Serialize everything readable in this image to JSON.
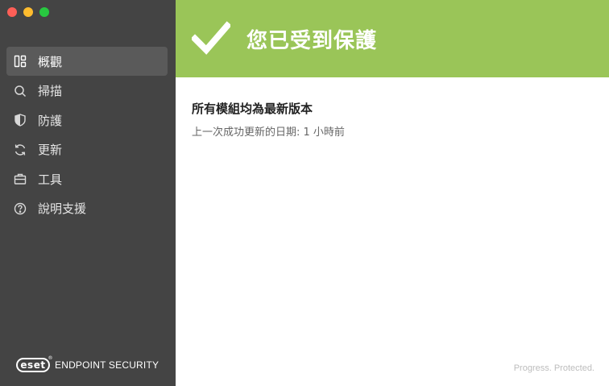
{
  "window": {
    "controls": [
      "close",
      "minimize",
      "maximize"
    ]
  },
  "sidebar": {
    "items": [
      {
        "label": "概觀",
        "icon": "overview-icon",
        "active": true
      },
      {
        "label": "掃描",
        "icon": "search-icon",
        "active": false
      },
      {
        "label": "防護",
        "icon": "shield-icon",
        "active": false
      },
      {
        "label": "更新",
        "icon": "refresh-icon",
        "active": false
      },
      {
        "label": "工具",
        "icon": "briefcase-icon",
        "active": false
      },
      {
        "label": "說明支援",
        "icon": "help-icon",
        "active": false
      }
    ],
    "brand": {
      "logo_text": "eset",
      "registered": "®",
      "product": "ENDPOINT SECURITY"
    }
  },
  "banner": {
    "title": "您已受到保護",
    "icon": "checkmark-icon"
  },
  "main": {
    "status_title": "所有模組均為最新版本",
    "status_subtitle": "上一次成功更新的日期:  1 小時前"
  },
  "footer": {
    "tagline": "Progress. Protected."
  },
  "colors": {
    "sidebar_bg": "#444444",
    "sidebar_active": "#5a5a5a",
    "banner_green": "#9ac558",
    "close": "#fe5f57",
    "minimize": "#febc2e",
    "maximize": "#28c840"
  }
}
